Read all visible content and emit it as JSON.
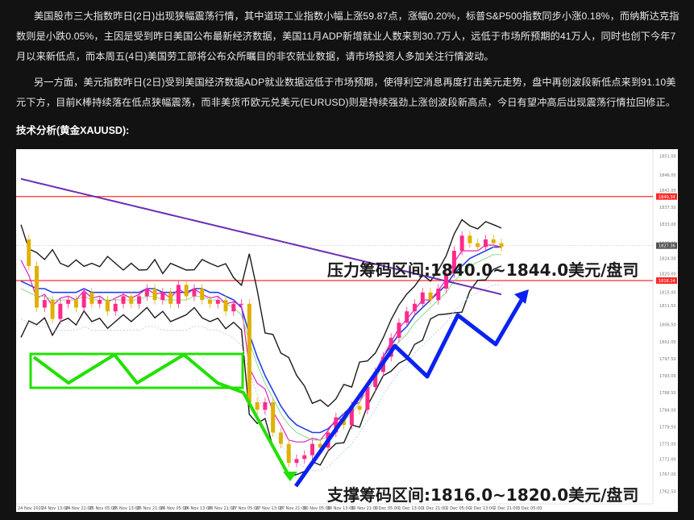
{
  "article": {
    "paragraph1": "美国股市三大指数昨日(2日)出现狭幅震荡行情，其中道琼工业指数小幅上涨59.87点，涨幅0.20%，标普S&P500指数同步小涨0.18%，而纳斯达克指数则是小跌0.05%，主因是受到昨日美国公布最新经济数据，美国11月ADP新增就业人数来到30.7万人，远低于市场所预期的41万人，同时也创下今年7月以来新低点，而本周五(4日)美国劳工部将公布众所瞩目的非农就业数据，请市场投资人多加关注行情波动。",
    "paragraph2": "另一方面，美元指数昨日(2日)受到美国经济数据ADP就业数据远低于市场预期，使得利空消息再度打击美元走势，盘中再创波段新低点来到91.10美元下方，目前K棒持续落在低点狭幅震荡，而非美货币欧元兑美元(EURUSD)则是持续强劲上涨创波段新高点，今日有望冲高后出现震荡行情拉回修正。",
    "section_title": "技术分析(黄金XAUUSD):"
  },
  "chart": {
    "annotation_resistance": "压力筹码区间:1840.0~1844.0美元/盘司",
    "annotation_support": "支撑筹码区间:1816.0~1820.0美元/盘司",
    "colors": {
      "background": "#ffffff",
      "resistance_line": "#ff2b2b",
      "ma_long": "#6a2fb5",
      "bollinger": "#1a1a1a",
      "range_box": "#22e000",
      "up_arrows": "#0a22f0",
      "candle_up": "#ff2a8a",
      "candle_down": "#e0b000"
    },
    "icons": [
      "range-box",
      "down-arrow-green",
      "up-arrow-blue"
    ]
  },
  "chart_data": {
    "type": "candlestick",
    "instrument": "XAUUSD",
    "price_labels": [
      "1851.00",
      "1846.00",
      "1842.00",
      "1837.50",
      "1833.00",
      "1828.00",
      "1824.00",
      "1820.00",
      "1815.00",
      "1811.50",
      "1806.50",
      "1802.00",
      "1797.50",
      "1793.00",
      "1788.50",
      "1784.00",
      "1779.50",
      "1775.00",
      "1771.00",
      "1767.00",
      "1762.50"
    ],
    "current_price_label": "1827.36",
    "resistance_price_label": "1840.34",
    "support_price_label": "1818.14",
    "x_tick_labels": [
      "24 Nov 2020",
      "24 Nov 13:00",
      "24 Nov 21:00",
      "25 Nov 05:00",
      "25 Nov 13:00",
      "25 Nov 21:00",
      "26 Nov 05:00",
      "26 Nov 13:00",
      "26 Nov 21:00",
      "27 Nov 05:00",
      "27 Nov 13:00",
      "27 Nov 21:00",
      "30 Nov 05:00",
      "30 Nov 13:00",
      "30 Nov 21:00",
      "1 Dec 05:00",
      "1 Dec 13:00",
      "1 Dec 21:00",
      "2 Dec 05:00",
      "2 Dec 13:00",
      "2 Dec 21:00",
      "3 Dec 05:00"
    ],
    "ylim": [
      1760,
      1852
    ],
    "series": [
      {
        "values": [
          1829,
          1822,
          1811,
          1813,
          1808,
          1812,
          1813,
          1811,
          1815,
          1812,
          1813,
          1810,
          1812,
          1814,
          1812,
          1814,
          1816,
          1813,
          1815,
          1812,
          1817,
          1814,
          1816,
          1813,
          1812,
          1813,
          1810,
          1812,
          1812,
          1786,
          1784,
          1786,
          1778,
          1775,
          1770,
          1771,
          1772,
          1775,
          1774,
          1778,
          1782,
          1780,
          1785,
          1784,
          1790,
          1794,
          1798,
          1803,
          1807,
          1810,
          1812,
          1815,
          1813,
          1816,
          1820,
          1826,
          1830,
          1828,
          1827,
          1829,
          1828,
          1827
        ]
      },
      {
        "values": [
          1818,
          1817,
          1816,
          1816,
          1815,
          1815,
          1815,
          1815,
          1816,
          1815,
          1815,
          1815,
          1815,
          1815,
          1815,
          1815,
          1816,
          1816,
          1815,
          1815,
          1815,
          1815,
          1816,
          1816,
          1815,
          1815,
          1814,
          1813,
          1811,
          1804,
          1798,
          1793,
          1789,
          1785,
          1782,
          1780,
          1779,
          1778,
          1778,
          1779,
          1781,
          1783,
          1785,
          1788,
          1791,
          1794,
          1798,
          1801,
          1804,
          1806,
          1809,
          1811,
          1813,
          1815,
          1817,
          1820,
          1822,
          1824,
          1825,
          1826,
          1827,
          1827
        ]
      },
      {
        "values": [
          1845,
          1844.5,
          1844,
          1843.5,
          1843,
          1842.5,
          1842,
          1841.5,
          1841,
          1840.5,
          1840,
          1839.5,
          1839,
          1838.5,
          1838,
          1837.5,
          1837,
          1836.5,
          1836,
          1835.5,
          1835,
          1834.5,
          1834,
          1833.5,
          1833,
          1832.5,
          1832,
          1831.5,
          1831,
          1830.5,
          1830,
          1829.5,
          1829,
          1828.5,
          1828,
          1827.5,
          1827,
          1826.5,
          1826,
          1825.5,
          1825,
          1824.5,
          1824,
          1823.5,
          1823,
          1822.5,
          1822,
          1821.5,
          1821,
          1820.5,
          1820,
          1819.5,
          1819,
          1818.5,
          1818,
          1817.5,
          1817,
          1816.5,
          1816,
          1815.5,
          1815,
          1814.5
        ]
      }
    ]
  }
}
